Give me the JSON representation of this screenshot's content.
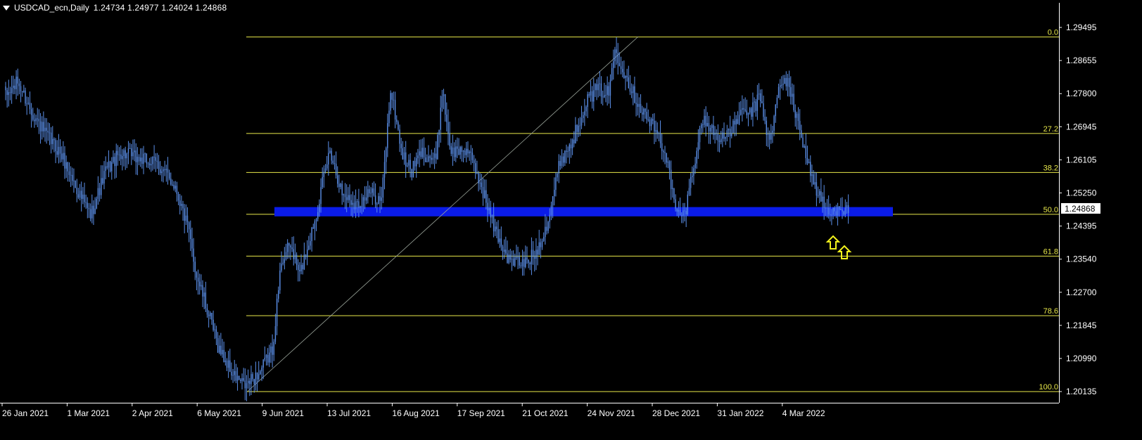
{
  "header": {
    "symbol": "USDCAD_ecn,Daily",
    "ohlc": "1.24734 1.24977 1.24024 1.24868"
  },
  "colors": {
    "background": "#000000",
    "candle": "#5b8fe8",
    "fib": "#e8e84a",
    "zone": "#0a1be8",
    "price_tag_bg": "#ffffff",
    "axis": "#ffffff",
    "arrows": "#f2f21c"
  },
  "icons": {
    "menu": "triangle-down-icon",
    "arrows": "up-arrow-icon"
  },
  "chart_data": {
    "type": "candlestick",
    "title": "",
    "xlabel": "",
    "ylabel": "",
    "ylim": [
      1.1976,
      1.3019
    ],
    "price_labels": [
      "1.29495",
      "1.28655",
      "1.27800",
      "1.26945",
      "1.26105",
      "1.25250",
      "1.24395",
      "1.23540",
      "1.22700",
      "1.21845",
      "1.20990",
      "1.20135"
    ],
    "date_labels": [
      "26 Jan 2021",
      "1 Mar 2021",
      "2 Apr 2021",
      "6 May 2021",
      "9 Jun 2021",
      "13 Jul 2021",
      "16 Aug 2021",
      "17 Sep 2021",
      "21 Oct 2021",
      "24 Nov 2021",
      "28 Dec 2021",
      "31 Jan 2022",
      "4 Mar 2022"
    ],
    "current_price": "1.24868",
    "fibonacci": {
      "high": 1.2962,
      "low": 1.2007,
      "levels": [
        {
          "label": "0.0",
          "ratio": 0.0
        },
        {
          "label": "27.2",
          "ratio": 0.272
        },
        {
          "label": "38.2",
          "ratio": 0.382
        },
        {
          "label": "50.0",
          "ratio": 0.5
        },
        {
          "label": "61.8",
          "ratio": 0.618
        },
        {
          "label": "78.6",
          "ratio": 0.786
        },
        {
          "label": "100.0",
          "ratio": 1.0
        }
      ]
    },
    "support_zone": {
      "top": 1.2503,
      "bottom": 1.2478
    },
    "trendline": {
      "from": 1.2007,
      "to": 1.2962
    },
    "arrows": 2,
    "anchors": [
      {
        "i": 0,
        "p": 1.28
      },
      {
        "i": 8,
        "p": 1.284
      },
      {
        "i": 16,
        "p": 1.277
      },
      {
        "i": 26,
        "p": 1.27
      },
      {
        "i": 36,
        "p": 1.265
      },
      {
        "i": 46,
        "p": 1.256
      },
      {
        "i": 56,
        "p": 1.248
      },
      {
        "i": 66,
        "p": 1.26
      },
      {
        "i": 76,
        "p": 1.265
      },
      {
        "i": 90,
        "p": 1.263
      },
      {
        "i": 100,
        "p": 1.262
      },
      {
        "i": 112,
        "p": 1.256
      },
      {
        "i": 120,
        "p": 1.245
      },
      {
        "i": 126,
        "p": 1.232
      },
      {
        "i": 132,
        "p": 1.224
      },
      {
        "i": 140,
        "p": 1.213
      },
      {
        "i": 150,
        "p": 1.205
      },
      {
        "i": 158,
        "p": 1.202
      },
      {
        "i": 168,
        "p": 1.206
      },
      {
        "i": 176,
        "p": 1.212
      },
      {
        "i": 182,
        "p": 1.236
      },
      {
        "i": 188,
        "p": 1.24
      },
      {
        "i": 194,
        "p": 1.232
      },
      {
        "i": 204,
        "p": 1.247
      },
      {
        "i": 214,
        "p": 1.266
      },
      {
        "i": 222,
        "p": 1.254
      },
      {
        "i": 232,
        "p": 1.251
      },
      {
        "i": 240,
        "p": 1.254
      },
      {
        "i": 248,
        "p": 1.252
      },
      {
        "i": 254,
        "p": 1.282
      },
      {
        "i": 262,
        "p": 1.264
      },
      {
        "i": 268,
        "p": 1.26
      },
      {
        "i": 274,
        "p": 1.265
      },
      {
        "i": 284,
        "p": 1.263
      },
      {
        "i": 288,
        "p": 1.282
      },
      {
        "i": 294,
        "p": 1.265
      },
      {
        "i": 304,
        "p": 1.266
      },
      {
        "i": 314,
        "p": 1.256
      },
      {
        "i": 322,
        "p": 1.245
      },
      {
        "i": 332,
        "p": 1.236
      },
      {
        "i": 342,
        "p": 1.235
      },
      {
        "i": 350,
        "p": 1.238
      },
      {
        "i": 358,
        "p": 1.247
      },
      {
        "i": 366,
        "p": 1.263
      },
      {
        "i": 374,
        "p": 1.268
      },
      {
        "i": 382,
        "p": 1.278
      },
      {
        "i": 390,
        "p": 1.282
      },
      {
        "i": 398,
        "p": 1.281
      },
      {
        "i": 402,
        "p": 1.293
      },
      {
        "i": 408,
        "p": 1.287
      },
      {
        "i": 414,
        "p": 1.281
      },
      {
        "i": 422,
        "p": 1.275
      },
      {
        "i": 430,
        "p": 1.27
      },
      {
        "i": 436,
        "p": 1.264
      },
      {
        "i": 442,
        "p": 1.249
      },
      {
        "i": 448,
        "p": 1.248
      },
      {
        "i": 454,
        "p": 1.262
      },
      {
        "i": 460,
        "p": 1.274
      },
      {
        "i": 468,
        "p": 1.27
      },
      {
        "i": 476,
        "p": 1.269
      },
      {
        "i": 484,
        "p": 1.275
      },
      {
        "i": 492,
        "p": 1.276
      },
      {
        "i": 498,
        "p": 1.28
      },
      {
        "i": 504,
        "p": 1.267
      },
      {
        "i": 510,
        "p": 1.282
      },
      {
        "i": 516,
        "p": 1.285
      },
      {
        "i": 520,
        "p": 1.277
      },
      {
        "i": 526,
        "p": 1.268
      },
      {
        "i": 532,
        "p": 1.258
      },
      {
        "i": 538,
        "p": 1.252
      },
      {
        "i": 544,
        "p": 1.248
      },
      {
        "i": 550,
        "p": 1.251
      },
      {
        "i": 556,
        "p": 1.2487
      }
    ]
  }
}
